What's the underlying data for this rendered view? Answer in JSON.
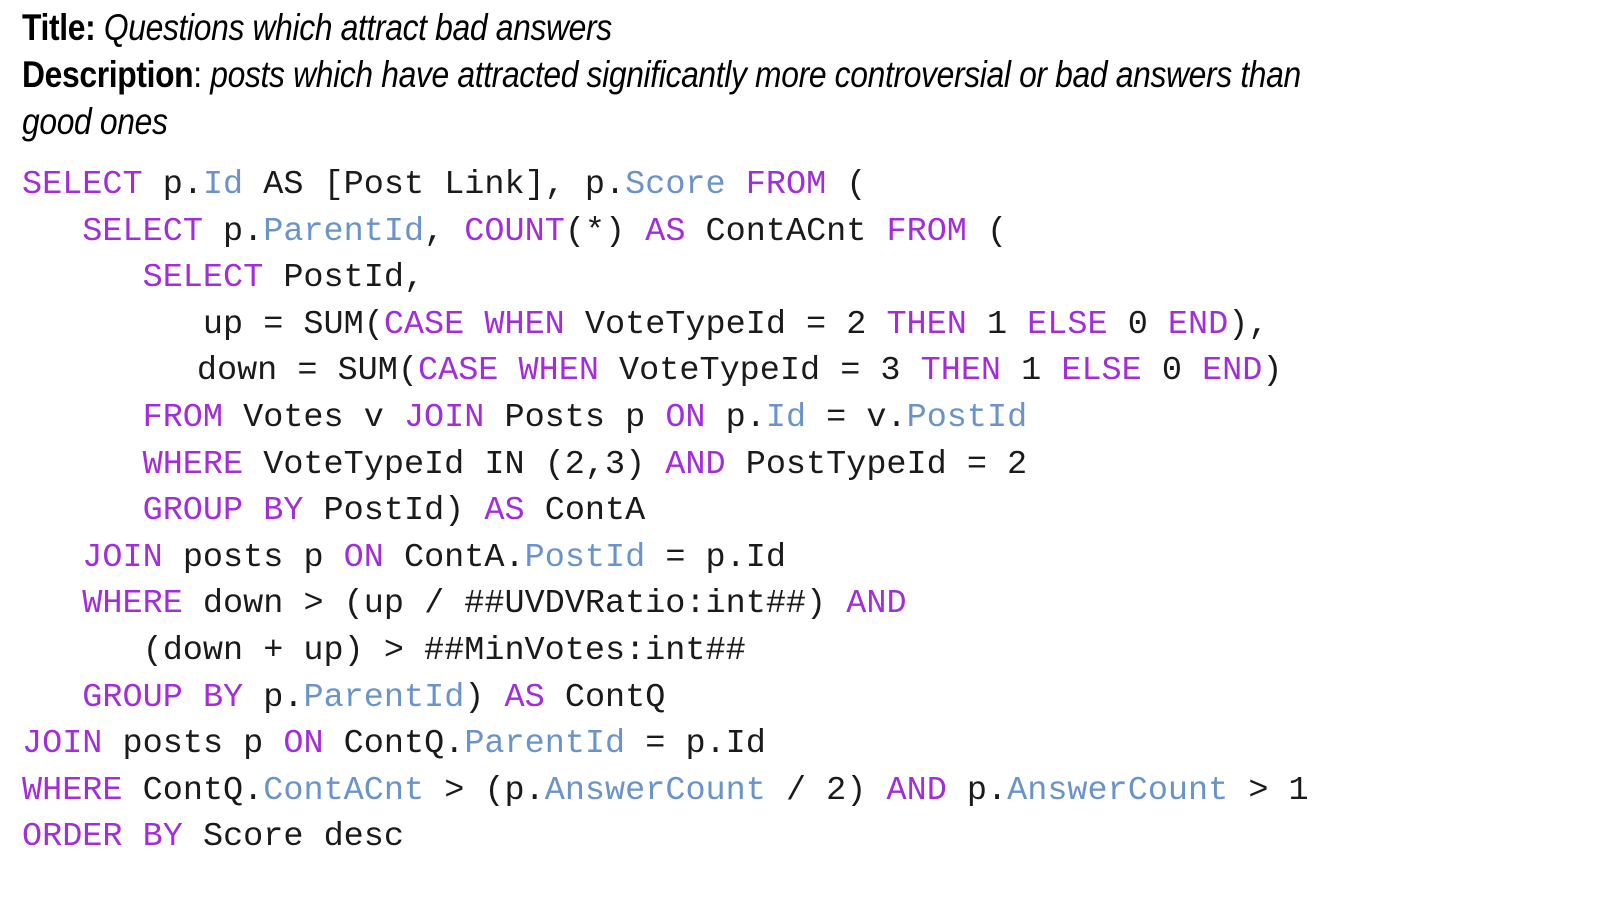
{
  "header": {
    "title_label": "Title:",
    "title_value": " Questions which attract bad answers",
    "description_label": "Description",
    "description_colon": ": ",
    "description_value": "posts which have attracted significantly more controversial or bad answers than good ones"
  },
  "colors": {
    "keyword": "#a12ddb",
    "identifier": "#6a93cb",
    "plain": "#1a1a1a",
    "background": "#ffffff"
  },
  "code": {
    "language": "sql",
    "lines": [
      {
        "indent": 0,
        "tokens": [
          {
            "t": "kw",
            "s": "SELECT"
          },
          {
            "t": "pl",
            "s": " p."
          },
          {
            "t": "id",
            "s": "Id"
          },
          {
            "t": "pl",
            "s": " AS [Post Link], p."
          },
          {
            "t": "id",
            "s": "Score"
          },
          {
            "t": "pl",
            "s": " "
          },
          {
            "t": "kw",
            "s": "FROM"
          },
          {
            "t": "pl",
            "s": " ("
          }
        ]
      },
      {
        "indent": 3,
        "tokens": [
          {
            "t": "kw",
            "s": "SELECT"
          },
          {
            "t": "pl",
            "s": " p."
          },
          {
            "t": "id",
            "s": "ParentId"
          },
          {
            "t": "pl",
            "s": ", "
          },
          {
            "t": "kw",
            "s": "COUNT"
          },
          {
            "t": "pl",
            "s": "(*) "
          },
          {
            "t": "kw",
            "s": "AS"
          },
          {
            "t": "pl",
            "s": " ContACnt "
          },
          {
            "t": "kw",
            "s": "FROM"
          },
          {
            "t": "pl",
            "s": " ("
          }
        ]
      },
      {
        "indent": 6,
        "tokens": [
          {
            "t": "kw",
            "s": "SELECT"
          },
          {
            "t": "pl",
            "s": " PostId,"
          }
        ]
      },
      {
        "indent": 9,
        "tokens": [
          {
            "t": "pl",
            "s": "up = SUM("
          },
          {
            "t": "kw",
            "s": "CASE"
          },
          {
            "t": "pl",
            "s": " "
          },
          {
            "t": "kw",
            "s": "WHEN"
          },
          {
            "t": "pl",
            "s": " VoteTypeId = 2 "
          },
          {
            "t": "kw",
            "s": "THEN"
          },
          {
            "t": "pl",
            "s": " 1 "
          },
          {
            "t": "kw",
            "s": "ELSE"
          },
          {
            "t": "pl",
            "s": " 0 "
          },
          {
            "t": "kw",
            "s": "END"
          },
          {
            "t": "pl",
            "s": "),"
          }
        ]
      },
      {
        "indent": 8.7,
        "tokens": [
          {
            "t": "pl",
            "s": "down = SUM("
          },
          {
            "t": "kw",
            "s": "CASE"
          },
          {
            "t": "pl",
            "s": " "
          },
          {
            "t": "kw",
            "s": "WHEN"
          },
          {
            "t": "pl",
            "s": " VoteTypeId = 3 "
          },
          {
            "t": "kw",
            "s": "THEN"
          },
          {
            "t": "pl",
            "s": " 1 "
          },
          {
            "t": "kw",
            "s": "ELSE"
          },
          {
            "t": "pl",
            "s": " 0 "
          },
          {
            "t": "kw",
            "s": "END"
          },
          {
            "t": "pl",
            "s": ")"
          }
        ]
      },
      {
        "indent": 6,
        "tokens": [
          {
            "t": "kw",
            "s": "FROM"
          },
          {
            "t": "pl",
            "s": " Votes v "
          },
          {
            "t": "kw",
            "s": "JOIN"
          },
          {
            "t": "pl",
            "s": " Posts p "
          },
          {
            "t": "kw",
            "s": "ON"
          },
          {
            "t": "pl",
            "s": " p."
          },
          {
            "t": "id",
            "s": "Id"
          },
          {
            "t": "pl",
            "s": " = v."
          },
          {
            "t": "id",
            "s": "PostId"
          }
        ]
      },
      {
        "indent": 6,
        "tokens": [
          {
            "t": "kw",
            "s": "WHERE"
          },
          {
            "t": "pl",
            "s": " VoteTypeId IN (2,3) "
          },
          {
            "t": "kw",
            "s": "AND"
          },
          {
            "t": "pl",
            "s": " PostTypeId = 2"
          }
        ]
      },
      {
        "indent": 6,
        "tokens": [
          {
            "t": "kw",
            "s": "GROUP"
          },
          {
            "t": "pl",
            "s": " "
          },
          {
            "t": "kw",
            "s": "BY"
          },
          {
            "t": "pl",
            "s": " PostId) "
          },
          {
            "t": "kw",
            "s": "AS"
          },
          {
            "t": "pl",
            "s": " ContA"
          }
        ]
      },
      {
        "indent": 3,
        "tokens": [
          {
            "t": "kw",
            "s": "JOIN"
          },
          {
            "t": "pl",
            "s": " posts p "
          },
          {
            "t": "kw",
            "s": "ON"
          },
          {
            "t": "pl",
            "s": " ContA."
          },
          {
            "t": "id",
            "s": "PostId"
          },
          {
            "t": "pl",
            "s": " = p.Id"
          }
        ]
      },
      {
        "indent": 3,
        "tokens": [
          {
            "t": "kw",
            "s": "WHERE"
          },
          {
            "t": "pl",
            "s": " down > (up / ##UVDVRatio:int##) "
          },
          {
            "t": "kw",
            "s": "AND"
          }
        ]
      },
      {
        "indent": 6,
        "tokens": [
          {
            "t": "pl",
            "s": "(down + up) > ##MinVotes:int##"
          }
        ]
      },
      {
        "indent": 3,
        "tokens": [
          {
            "t": "kw",
            "s": "GROUP"
          },
          {
            "t": "pl",
            "s": " "
          },
          {
            "t": "kw",
            "s": "BY"
          },
          {
            "t": "pl",
            "s": " p."
          },
          {
            "t": "id",
            "s": "ParentId"
          },
          {
            "t": "pl",
            "s": ") "
          },
          {
            "t": "kw",
            "s": "AS"
          },
          {
            "t": "pl",
            "s": " ContQ"
          }
        ]
      },
      {
        "indent": 0,
        "tokens": [
          {
            "t": "kw",
            "s": "JOIN"
          },
          {
            "t": "pl",
            "s": " posts p "
          },
          {
            "t": "kw",
            "s": "ON"
          },
          {
            "t": "pl",
            "s": " ContQ."
          },
          {
            "t": "id",
            "s": "ParentId"
          },
          {
            "t": "pl",
            "s": " = p.Id"
          }
        ]
      },
      {
        "indent": 0,
        "tokens": [
          {
            "t": "kw",
            "s": "WHERE"
          },
          {
            "t": "pl",
            "s": " ContQ."
          },
          {
            "t": "id",
            "s": "ContACnt"
          },
          {
            "t": "pl",
            "s": " > (p."
          },
          {
            "t": "id",
            "s": "AnswerCount"
          },
          {
            "t": "pl",
            "s": " / 2) "
          },
          {
            "t": "kw",
            "s": "AND"
          },
          {
            "t": "pl",
            "s": " p."
          },
          {
            "t": "id",
            "s": "AnswerCount"
          },
          {
            "t": "pl",
            "s": " > 1"
          }
        ]
      },
      {
        "indent": 0,
        "tokens": [
          {
            "t": "kw",
            "s": "ORDER"
          },
          {
            "t": "pl",
            "s": " "
          },
          {
            "t": "kw",
            "s": "BY"
          },
          {
            "t": "pl",
            "s": " Score desc"
          }
        ]
      }
    ]
  }
}
